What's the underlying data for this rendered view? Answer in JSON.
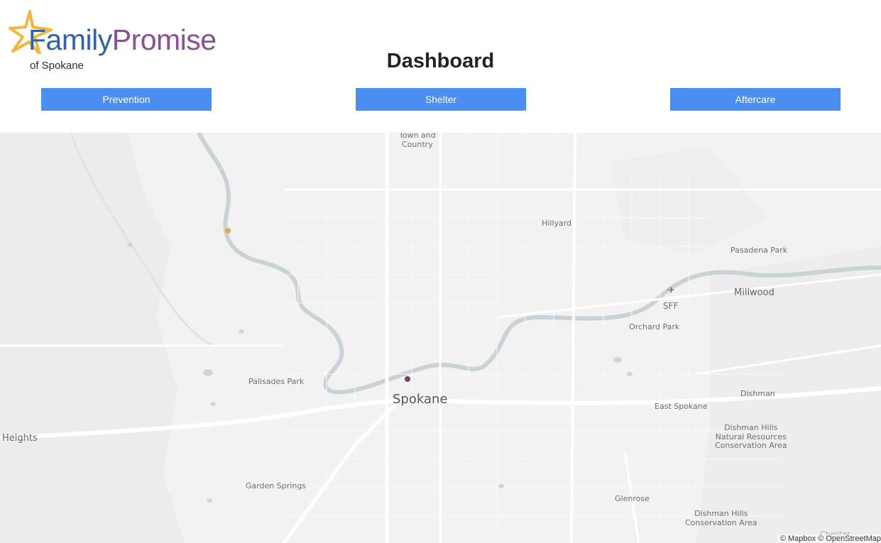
{
  "logo": {
    "part1": "Family",
    "part2": "Promise",
    "sub": "of Spokane"
  },
  "page": {
    "title": "Dashboard"
  },
  "nav": {
    "prevention": "Prevention",
    "shelter": "Shelter",
    "aftercare": "Aftercare"
  },
  "map": {
    "labels": {
      "town_country": "Town and\nCountry",
      "hillyard": "Hillyard",
      "pasadena_park": "Pasadena Park",
      "millwood": "Millwood",
      "sff": "SFF",
      "orchard_park": "Orchard Park",
      "palisades_park": "Palisades Park",
      "spokane": "Spokane",
      "heights": "Heights",
      "dishman": "Dishman",
      "east_spokane": "East Spokane",
      "dishman_hills_nra": "Dishman Hills\nNatural Resources\nConservation Area",
      "garden_springs": "Garden Springs",
      "glenrose": "Glenrose",
      "dishman_hills_ca": "Dishman Hills\nConservation Area",
      "chester": "Chester"
    },
    "attribution": "© Mapbox © OpenStreetMap",
    "markers": [
      {
        "name": "prevention-marker",
        "color": "#e0a64a"
      },
      {
        "name": "shelter-marker",
        "color": "#7a3b6e"
      }
    ]
  },
  "colors": {
    "button": "#4a8ef2",
    "brand_blue": "#2f62ad",
    "brand_purple": "#8c4e98",
    "star": "#f2b63a"
  }
}
